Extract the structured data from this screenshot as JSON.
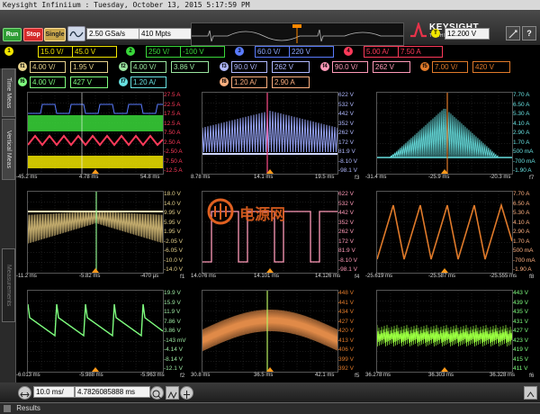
{
  "window": {
    "title": "Keysight Infiniium : Tuesday, October 13, 2015 5:17:59 PM"
  },
  "toolbar": {
    "run": "Run",
    "stop": "Stop",
    "single": "Single",
    "sample_rate": "2.50 GSa/s",
    "memory_depth": "410 Mpts",
    "trigger_level": "12.200 V",
    "trigger_chip": "T",
    "help": "?"
  },
  "brand": {
    "name": "KEYSIGHT",
    "sub": "TECHNOLOGIES"
  },
  "channels_row1": [
    {
      "chip": "1",
      "scale": "15.0 V/",
      "offset": "45.0 V",
      "color": "#f2e600"
    },
    {
      "chip": "2",
      "scale": "250 V/",
      "offset": "-100 V",
      "color": "#39d83a"
    },
    {
      "chip": "3",
      "scale": "60.0 V/",
      "offset": "220 V",
      "color": "#5a7cff"
    },
    {
      "chip": "4",
      "scale": "5.00 A/",
      "offset": "7.50 A",
      "color": "#ff3a5a"
    }
  ],
  "channels_row2": [
    {
      "chip": "f1",
      "scale": "4.00 V/",
      "offset": "1.95 V",
      "color": "#e6d28c"
    },
    {
      "chip": "f2",
      "scale": "4.00 V/",
      "offset": "3.86 V",
      "color": "#9ae6a0"
    },
    {
      "chip": "f3",
      "scale": "90.0 V/",
      "offset": "262 V",
      "color": "#b0b8ff"
    },
    {
      "chip": "f4",
      "scale": "90.0 V/",
      "offset": "262 V",
      "color": "#ff9ab8"
    },
    {
      "chip": "f5",
      "scale": "7.00 V/",
      "offset": "420 V",
      "color": "#e07a2a"
    }
  ],
  "channels_row3": [
    {
      "chip": "f6",
      "scale": "4.00 V/",
      "offset": "427 V",
      "color": "#7fff7f"
    },
    {
      "chip": "f7",
      "scale": "1.20 A/",
      "offset": "",
      "color": "#67e0e0"
    },
    {
      "chip": "f8",
      "scale": "1.20 A/",
      "offset": "2.90 A",
      "color": "#ffb080"
    }
  ],
  "sidebar": {
    "time_meas": "Time Meas",
    "vertical_meas": "Vertical Meas",
    "measurements": "Measurements"
  },
  "panels": [
    {
      "id": "p1",
      "y_labels": [
        "27.5 A",
        "22.5 A",
        "17.5 A",
        "12.5 A",
        "7.50 A",
        "2.50 A",
        "-2.50 A",
        "-7.50 A",
        "-12.5 A"
      ],
      "y_colors": [
        "#ff3a5a",
        "#ff3a5a",
        "#ff3a5a",
        "#ff3a5a",
        "#ff3a5a",
        "#ff3a5a",
        "#ff3a5a",
        "#ff3a5a",
        "#ff3a5a"
      ],
      "t_left": "-45.2 ms",
      "t_mid": "4.78 ms",
      "t_right": "54.8 ms",
      "fn": ""
    },
    {
      "id": "p2",
      "y_labels": [
        "622 V",
        "532 V",
        "442 V",
        "352 V",
        "262 V",
        "172 V",
        "81.9 V",
        "-8.10 V",
        "-98.1 V"
      ],
      "y_colors": [
        "#b0b8ff",
        "#b0b8ff",
        "#b0b8ff",
        "#b0b8ff",
        "#b0b8ff",
        "#b0b8ff",
        "#b0b8ff",
        "#b0b8ff",
        "#b0b8ff"
      ],
      "t_left": "8.78 ms",
      "t_mid": "14.1 ms",
      "t_right": "19.5 ms",
      "fn": "f3"
    },
    {
      "id": "p3",
      "y_labels": [
        "7.70 A",
        "6.50 A",
        "5.30 A",
        "4.10 A",
        "2.90 A",
        "1.70 A",
        "500 mA",
        "-700 mA",
        "-1.90 A"
      ],
      "y_colors": [
        "#67e0e0",
        "#67e0e0",
        "#67e0e0",
        "#67e0e0",
        "#67e0e0",
        "#67e0e0",
        "#67e0e0",
        "#67e0e0",
        "#67e0e0"
      ],
      "t_left": "-31.4 ms",
      "t_mid": "-25.9 ms",
      "t_right": "-20.3 ms",
      "fn": "f7"
    },
    {
      "id": "p4",
      "y_labels": [
        "18.0 V",
        "14.0 V",
        "9.95 V",
        "5.95 V",
        "1.95 V",
        "-2.05 V",
        "-6.05 V",
        "-10.0 V",
        "-14.0 V"
      ],
      "y_colors": [
        "#e6d28c",
        "#e6d28c",
        "#e6d28c",
        "#e6d28c",
        "#e6d28c",
        "#e6d28c",
        "#e6d28c",
        "#e6d28c",
        "#e6d28c"
      ],
      "t_left": "-11.2 ms",
      "t_mid": "-5.82 ms",
      "t_right": "-470 µs",
      "fn": "f1"
    },
    {
      "id": "p5",
      "y_labels": [
        "622 V",
        "532 V",
        "442 V",
        "352 V",
        "262 V",
        "172 V",
        "81.9 V",
        "-8.10 V",
        "-98.1 V"
      ],
      "y_colors": [
        "#ff9ab8",
        "#ff9ab8",
        "#ff9ab8",
        "#ff9ab8",
        "#ff9ab8",
        "#ff9ab8",
        "#ff9ab8",
        "#ff9ab8",
        "#ff9ab8"
      ],
      "t_left": "14.076 ms",
      "t_mid": "14.101 ms",
      "t_right": "14.126 ms",
      "fn": "f4"
    },
    {
      "id": "p6",
      "y_labels": [
        "7.70 A",
        "6.50 A",
        "5.30 A",
        "4.10 A",
        "2.90 A",
        "1.70 A",
        "500 mA",
        "-700 mA",
        "-1.90 A"
      ],
      "y_colors": [
        "#ffb080",
        "#ffb080",
        "#ffb080",
        "#ffb080",
        "#ffb080",
        "#ffb080",
        "#ffb080",
        "#ffb080",
        "#ffb080"
      ],
      "t_left": "-25.619 ms",
      "t_mid": "-25.587 ms",
      "t_right": "-25.555 ms",
      "fn": "f8"
    },
    {
      "id": "p7",
      "y_labels": [
        "19.9 V",
        "15.9 V",
        "11.9 V",
        "7.86 V",
        "3.86 V",
        "-143 mV",
        "-4.14 V",
        "-8.14 V",
        "-12.1 V"
      ],
      "y_colors": [
        "#9ae6a0",
        "#9ae6a0",
        "#9ae6a0",
        "#9ae6a0",
        "#9ae6a0",
        "#9ae6a0",
        "#9ae6a0",
        "#9ae6a0",
        "#9ae6a0"
      ],
      "t_left": "-6.013 ms",
      "t_mid": "-5.988 ms",
      "t_right": "-5.963 ms",
      "fn": "f2"
    },
    {
      "id": "p8",
      "y_labels": [
        "448 V",
        "441 V",
        "434 V",
        "427 V",
        "420 V",
        "413 V",
        "406 V",
        "399 V",
        "392 V"
      ],
      "y_colors": [
        "#e07a2a",
        "#e07a2a",
        "#e07a2a",
        "#e07a2a",
        "#e07a2a",
        "#e07a2a",
        "#e07a2a",
        "#e07a2a",
        "#e07a2a"
      ],
      "t_left": "30.8 ms",
      "t_mid": "36.5 ms",
      "t_right": "42.1 ms",
      "fn": "f5"
    },
    {
      "id": "p9",
      "y_labels": [
        "443 V",
        "439 V",
        "435 V",
        "431 V",
        "427 V",
        "423 V",
        "419 V",
        "415 V",
        "411 V"
      ],
      "y_colors": [
        "#7fff7f",
        "#7fff7f",
        "#7fff7f",
        "#7fff7f",
        "#7fff7f",
        "#7fff7f",
        "#7fff7f",
        "#7fff7f",
        "#7fff7f"
      ],
      "t_left": "36.278 ms",
      "t_mid": "36.303 ms",
      "t_right": "36.328 ms",
      "fn": "f6"
    }
  ],
  "timebase": {
    "scale": "10.0 ms/",
    "position": "4.7826085888 ms"
  },
  "results": {
    "label": "Results"
  },
  "watermark": {
    "text": "电源网"
  }
}
